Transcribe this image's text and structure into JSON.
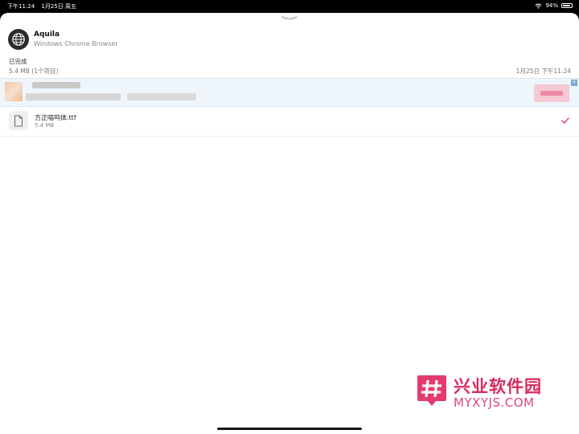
{
  "status_bar": {
    "time": "下午11:24",
    "date": "1月25日 周五",
    "battery": "94%"
  },
  "app": {
    "name": "Aquila",
    "subtitle": "Windows Chrome Browser"
  },
  "section": {
    "label": "已完成",
    "summary": "5.4 MB (1个项目)",
    "date": "1月25日 下午11:24"
  },
  "file": {
    "name": "方正喵呜体.ttf",
    "size": "5.4 MB"
  },
  "watermark": {
    "title": "兴业软件园",
    "subtitle": "MYXYJS.COM"
  },
  "icons": [
    "globe-icon",
    "document-icon",
    "checkmark-icon",
    "wifi-icon",
    "battery-icon",
    "grabber-icon"
  ],
  "colors": {
    "accent_check": "#e0406a",
    "watermark": "#d92a5e"
  }
}
